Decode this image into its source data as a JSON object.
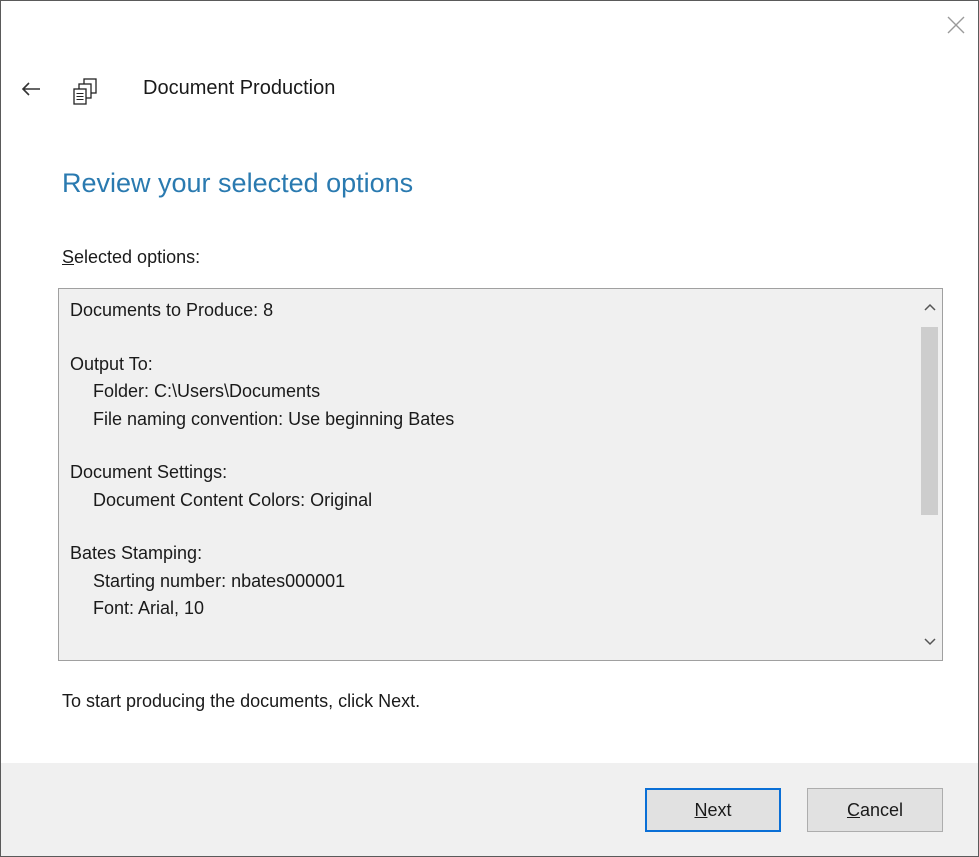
{
  "window": {
    "title": "Document Production",
    "close_icon": "close-icon",
    "back_icon": "back-arrow-icon",
    "app_icon": "document-production-icon"
  },
  "page": {
    "heading": "Review your selected options",
    "list_label_accel": "S",
    "list_label_rest": "elected options:",
    "instruction": "To start producing the documents, click Next."
  },
  "options": {
    "documents_line": "Documents to Produce: 8",
    "output_to": {
      "title": "Output To:",
      "folder": "Folder: C:\\Users\\Documents",
      "naming": "File naming convention: Use beginning Bates"
    },
    "document_settings": {
      "title": "Document Settings:",
      "colors": "Document Content Colors: Original"
    },
    "bates_stamping": {
      "title": "Bates Stamping:",
      "starting_number": "Starting number: nbates000001",
      "font": "Font: Arial, 10"
    }
  },
  "buttons": {
    "next_accel": "N",
    "next_rest": "ext",
    "cancel_accel": "C",
    "cancel_rest": "ancel"
  },
  "colors": {
    "heading": "#2a7ab0",
    "default_button_border": "#0a6fd6",
    "footer_bg": "#f0f0f0",
    "listbox_bg": "#f0f0f0"
  }
}
